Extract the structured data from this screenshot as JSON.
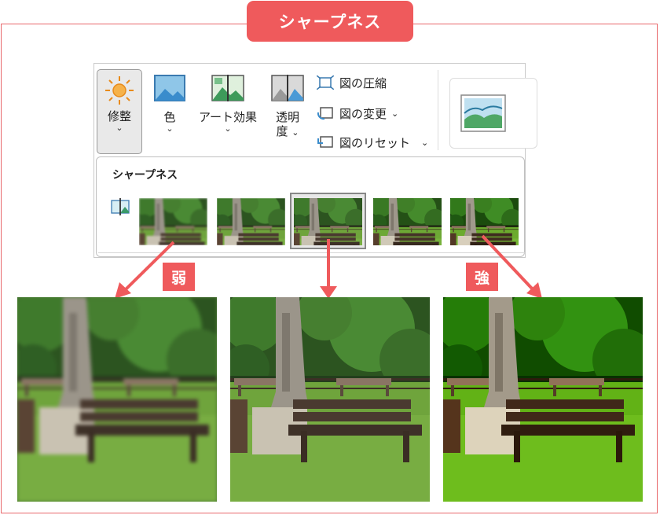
{
  "title": "シャープネス",
  "ribbon": {
    "adjust": {
      "line1": "修整",
      "chevron": "⌄"
    },
    "color": {
      "line1": "色",
      "chevron": "⌄"
    },
    "art_effects": {
      "line1": "アート効果",
      "chevron": "⌄"
    },
    "transparency": {
      "line1": "透明",
      "line2": "度",
      "chevron": "⌄"
    },
    "compress": {
      "label": "図の圧縮"
    },
    "change": {
      "label": "図の変更",
      "chevron": "⌄"
    },
    "reset": {
      "label": "図のリセット",
      "chevron": "⌄"
    }
  },
  "dropdown": {
    "title": "シャープネス",
    "selected_index": 2,
    "options": 5
  },
  "labels": {
    "weak": "弱",
    "strong": "強"
  },
  "colors": {
    "accent": "#ef5a5c",
    "grass": "#6fa43c",
    "foliage": "#2f5a22",
    "bench": "#4a3a30"
  },
  "icons": [
    "sun-icon",
    "picture-icon",
    "art-effect-icon",
    "transparency-icon",
    "compress-icon",
    "change-picture-icon",
    "reset-picture-icon",
    "sharpen-split-icon",
    "picture-style-icon",
    "arrow-icon"
  ]
}
